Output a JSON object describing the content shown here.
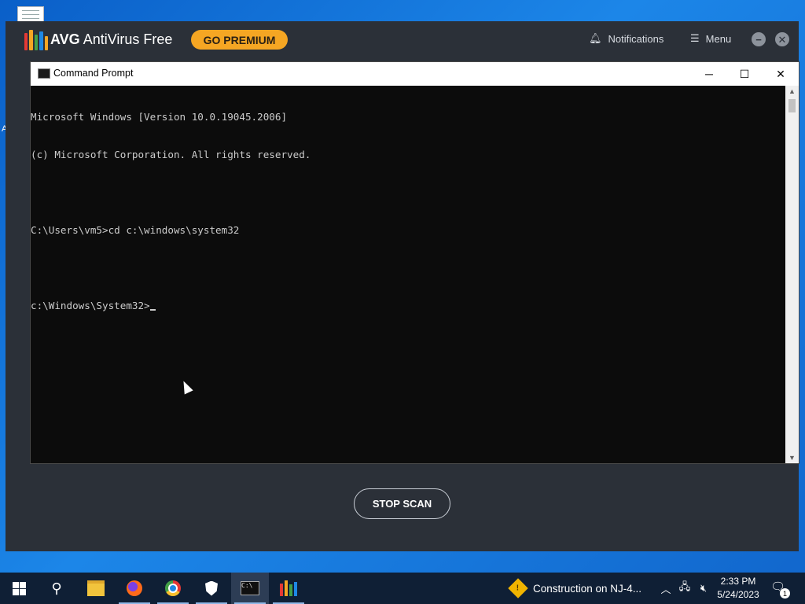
{
  "avg": {
    "brand_bold": "AVG",
    "brand_rest": "AntiVirus Free",
    "go_premium": "GO PREMIUM",
    "notifications": "Notifications",
    "menu": "Menu",
    "stop_scan": "STOP SCAN",
    "logo_colors": [
      "#e53935",
      "#f5a623",
      "#43a047",
      "#1e88e5",
      "#f5a623"
    ]
  },
  "cmd": {
    "title": "Command Prompt",
    "lines": [
      "Microsoft Windows [Version 10.0.19045.2006]",
      "(c) Microsoft Corporation. All rights reserved.",
      "",
      "C:\\Users\\vm5>cd c:\\windows\\system32",
      "",
      "c:\\Windows\\System32>"
    ],
    "minimize": "─",
    "maximize": "☐",
    "close": "✕"
  },
  "taskbar": {
    "news_text": "Construction on NJ-4...",
    "time": "2:33 PM",
    "date": "5/24/2023",
    "notification_count": "1"
  },
  "desktop": {
    "stray_letter": "A"
  }
}
